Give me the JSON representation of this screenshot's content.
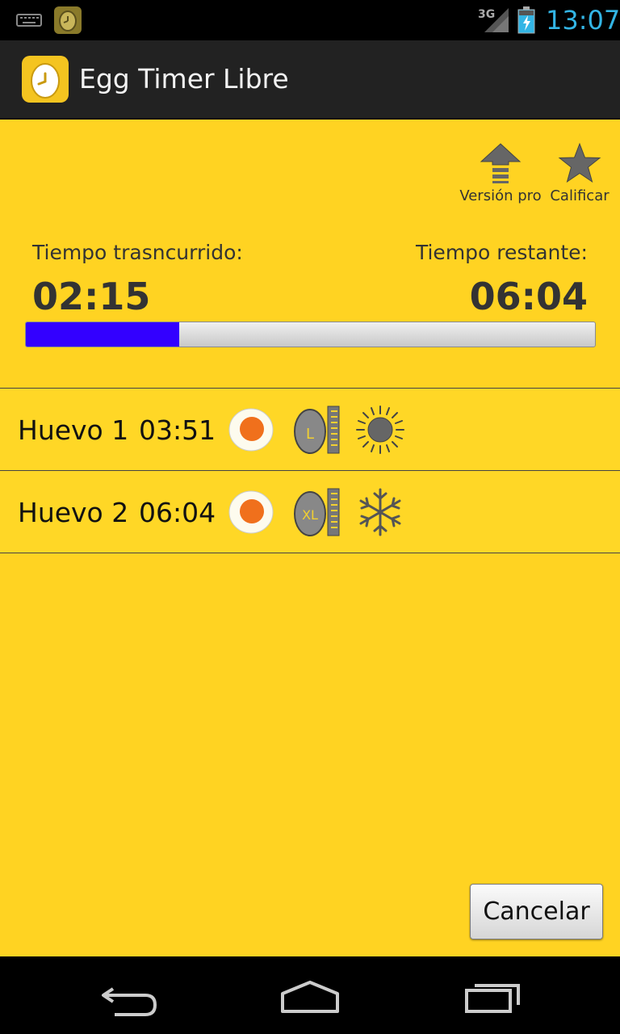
{
  "status_bar": {
    "time": "13:07",
    "network": "3G",
    "icons": [
      "keyboard-icon",
      "egg-timer-notification-icon",
      "signal-icon",
      "battery-charging-icon"
    ]
  },
  "action_bar": {
    "title": "Egg Timer Libre",
    "app_icon": "egg-clock-icon"
  },
  "toolbar": {
    "pro_label": "Versión pro",
    "pro_icon": "upgrade-arrow-icon",
    "rate_label": "Calificar",
    "rate_icon": "star-icon"
  },
  "timer": {
    "elapsed_label": "Tiempo trasncurrido:",
    "elapsed_value": "02:15",
    "remaining_label": "Tiempo restante:",
    "remaining_value": "06:04",
    "progress_fraction": 0.27,
    "progress_color": "#3300ff"
  },
  "eggs": [
    {
      "name": "Huevo 1",
      "time": "03:51",
      "doneness_icon": "soft-yolk-icon",
      "size": "L",
      "temp_icon": "sun-icon"
    },
    {
      "name": "Huevo 2",
      "time": "06:04",
      "doneness_icon": "soft-yolk-icon",
      "size": "XL",
      "temp_icon": "snowflake-icon"
    }
  ],
  "cancel_label": "Cancelar",
  "nav": [
    "back-icon",
    "home-icon",
    "recents-icon"
  ],
  "colors": {
    "background": "#ffd322",
    "action_bar": "#222222",
    "status_clock": "#33b5e5"
  }
}
